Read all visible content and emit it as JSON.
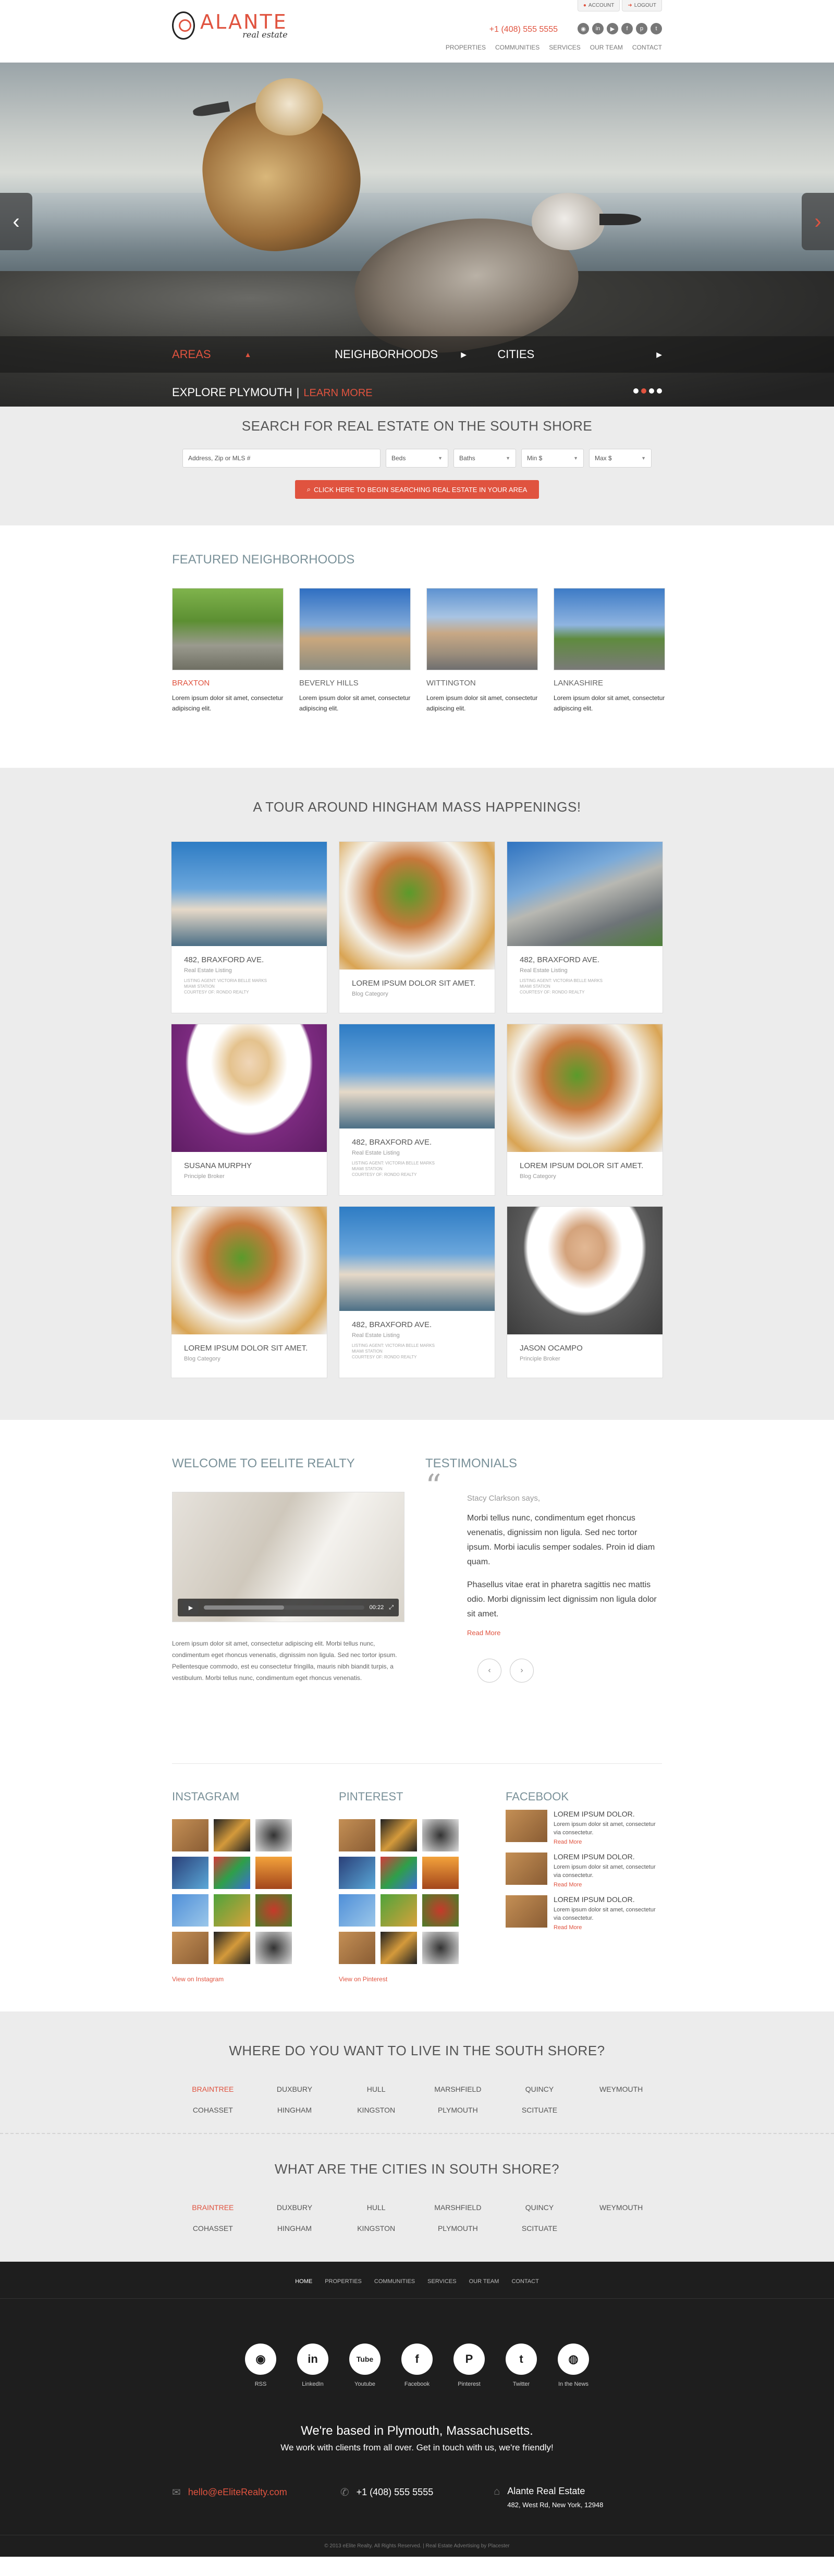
{
  "topbar": {
    "account": "ACCOUNT",
    "logout": "LOGOUT"
  },
  "logo": {
    "name": "ALANTE",
    "tagline": "real estate"
  },
  "phone": "+1 (408) 555 5555",
  "social_top": [
    "rss-icon",
    "linkedin-icon",
    "youtube-icon",
    "facebook-icon",
    "pinterest-icon",
    "twitter-icon"
  ],
  "nav": [
    "PROPERTIES",
    "COMMUNITIES",
    "SERVICES",
    "OUR TEAM",
    "CONTACT"
  ],
  "hero": {
    "tabs": [
      "AREAS",
      "NEIGHBORHOODS",
      "CITIES"
    ],
    "explore": "EXPLORE PLYMOUTH",
    "learn_more": "LEARN MORE",
    "slide_count": 4,
    "active_slide": 1
  },
  "search": {
    "title": "SEARCH FOR REAL ESTATE ON THE SOUTH SHORE",
    "address_placeholder": "Address, Zip or MLS #",
    "selects": [
      "Beds",
      "Baths",
      "Min $",
      "Max $"
    ],
    "button": "CLICK HERE TO BEGIN SEARCHING REAL ESTATE IN YOUR AREA"
  },
  "featured": {
    "title": "FEATURED NEIGHBORHOODS",
    "items": [
      {
        "name": "BRAXTON",
        "text": "Lorem ipsum dolor sit amet, consectetur adipiscing elit."
      },
      {
        "name": "BEVERLY HILLS",
        "text": "Lorem ipsum dolor sit amet, consectetur adipiscing elit."
      },
      {
        "name": "WITTINGTON",
        "text": "Lorem ipsum dolor sit amet, consectetur adipiscing elit."
      },
      {
        "name": "LANKASHIRE",
        "text": "Lorem ipsum dolor sit amet, consectetur adipiscing elit."
      }
    ]
  },
  "tour": {
    "title": "A TOUR AROUND HINGHAM MASS HAPPENINGS!",
    "cards": [
      {
        "title": "482, BRAXFORD AVE.",
        "sub": "Real Estate Listing",
        "extra": "LISTING AGENT: VICTORIA BELLE MARKS\nMIAMI STATION\nCOURTESY OF: RONDO REALTY"
      },
      {
        "title": "LOREM IPSUM DOLOR SIT AMET.",
        "sub": "Blog Category",
        "extra": ""
      },
      {
        "title": "482, BRAXFORD AVE.",
        "sub": "Real Estate Listing",
        "extra": "LISTING AGENT: VICTORIA BELLE MARKS\nMIAMI STATION\nCOURTESY OF: RONDO REALTY"
      },
      {
        "title": "SUSANA MURPHY",
        "sub": "Principle Broker",
        "extra": ""
      },
      {
        "title": "482, BRAXFORD AVE.",
        "sub": "Real Estate Listing",
        "extra": "LISTING AGENT: VICTORIA BELLE MARKS\nMIAMI STATION\nCOURTESY OF: RONDO REALTY"
      },
      {
        "title": "LOREM IPSUM DOLOR SIT AMET.",
        "sub": "Blog Category",
        "extra": ""
      },
      {
        "title": "LOREM IPSUM DOLOR SIT AMET.",
        "sub": "Blog Category",
        "extra": ""
      },
      {
        "title": "482, BRAXFORD AVE.",
        "sub": "Real Estate Listing",
        "extra": "LISTING AGENT: VICTORIA BELLE MARKS\nMIAMI STATION\nCOURTESY OF: RONDO REALTY"
      },
      {
        "title": "JASON OCAMPO",
        "sub": "Principle Broker",
        "extra": ""
      }
    ]
  },
  "welcome": {
    "title": "WELCOME TO eELITE REALTY",
    "video_time": "00:22",
    "text": "Lorem ipsum dolor sit amet, consectetur adipiscing elit. Morbi tellus nunc, condimentum eget rhoncus venenatis, dignissim non ligula. Sed nec tortor ipsum. Pellentesque commodo, est eu consectetur fringilla, mauris nibh biandit turpis, a vestibulum. Morbi tellus nunc, condimentum eget rhoncus venenatis."
  },
  "testimonials": {
    "title": "TESTIMONIALS",
    "who": "Stacy Clarkson says,",
    "p1": "Morbi tellus nunc, condimentum eget rhoncus venenatis, dignissim non ligula. Sed nec tortor ipsum. Morbi iaculis semper sodales. Proin id diam quam.",
    "p2": "Phasellus vitae erat in pharetra sagittis nec mattis odio. Morbi dignissim lect dignissim non ligula dolor sit amet.",
    "more": "Read More"
  },
  "feeds": {
    "instagram": {
      "title": "INSTAGRAM",
      "link": "View on Instagram"
    },
    "pinterest": {
      "title": "PINTEREST",
      "link": "View on Pinterest"
    },
    "facebook": {
      "title": "FACEBOOK",
      "items": [
        {
          "title": "LOREM IPSUM DOLOR.",
          "text": "Lorem ipsum dolor sit amet, consectetur via consectetur.",
          "more": "Read More"
        },
        {
          "title": "LOREM IPSUM DOLOR.",
          "text": "Lorem ipsum dolor sit amet, consectetur via consectetur.",
          "more": "Read More"
        },
        {
          "title": "LOREM IPSUM DOLOR.",
          "text": "Lorem ipsum dolor sit amet, consectetur via consectetur.",
          "more": "Read More"
        }
      ]
    }
  },
  "where": {
    "title": "WHERE DO YOU WANT TO LIVE IN THE SOUTH SHORE?",
    "cities": [
      "BRAINTREE",
      "DUXBURY",
      "HULL",
      "MARSHFIELD",
      "QUINCY",
      "WEYMOUTH",
      "COHASSET",
      "HINGHAM",
      "KINGSTON",
      "PLYMOUTH",
      "SCITUATE"
    ]
  },
  "cities": {
    "title": "WHAT ARE THE CITIES IN SOUTH SHORE?",
    "cities": [
      "BRAINTREE",
      "DUXBURY",
      "HULL",
      "MARSHFIELD",
      "QUINCY",
      "WEYMOUTH",
      "COHASSET",
      "HINGHAM",
      "KINGSTON",
      "PLYMOUTH",
      "SCITUATE"
    ]
  },
  "footer": {
    "nav": [
      "HOME",
      "PROPERTIES",
      "COMMUNITIES",
      "SERVICES",
      "OUR TEAM",
      "CONTACT"
    ],
    "icons": [
      {
        "name": "rss-icon",
        "label": "RSS"
      },
      {
        "name": "linkedin-icon",
        "label": "LinkedIn"
      },
      {
        "name": "youtube-icon",
        "label": "Youtube"
      },
      {
        "name": "facebook-icon",
        "label": "Facebook"
      },
      {
        "name": "pinterest-icon",
        "label": "Pinterest"
      },
      {
        "name": "twitter-icon",
        "label": "Twitter"
      },
      {
        "name": "globe-icon",
        "label": "In the News"
      }
    ],
    "based": "We're based in Plymouth, Massachusetts.",
    "work": "We work with clients from all over. Get in touch with us, we're friendly!",
    "email": "hello@eEliteRealty.com",
    "phone": "+1 (408) 555 5555",
    "company": "Alante Real Estate",
    "address": "482, West Rd, New York, 12948",
    "copyright": "© 2013 eElite Realty. All Rights Reserved. | Real Estate Advertising by Placester"
  },
  "colors": {
    "accent": "#e0533f",
    "footer_bg": "#1e1e1e",
    "section_bg": "#ececec"
  }
}
